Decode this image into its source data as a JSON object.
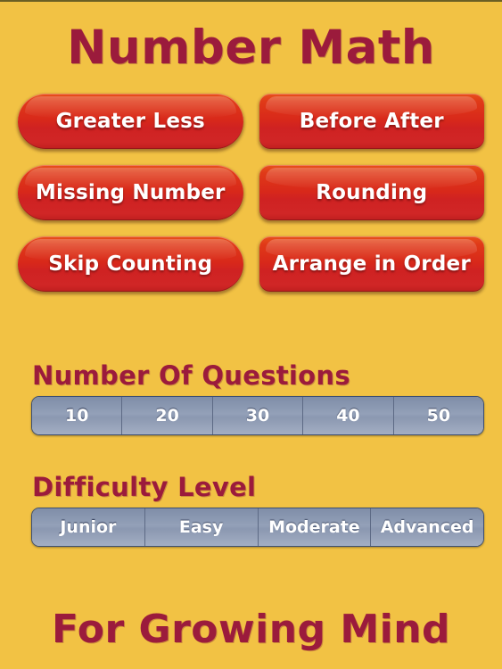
{
  "app": {
    "title": "Number Math",
    "footer": "For Growing Mind",
    "background_color": "#f2c244",
    "title_color": "#9b1b3c",
    "button_color": "#d8281a",
    "segment_selected_color": "#44588a",
    "segment_unselected_color": "#93a0b8"
  },
  "topics": {
    "rows": [
      [
        {
          "label": "Greater Less"
        },
        {
          "label": "Before After"
        }
      ],
      [
        {
          "label": "Missing Number"
        },
        {
          "label": "Rounding"
        }
      ],
      [
        {
          "label": "Skip Counting"
        },
        {
          "label": "Arrange in Order"
        }
      ]
    ]
  },
  "questions": {
    "label": "Number Of Questions",
    "options": [
      "10",
      "20",
      "30",
      "40",
      "50"
    ],
    "selected": "10"
  },
  "difficulty": {
    "label": "Difficulty Level",
    "options": [
      "Junior",
      "Easy",
      "Moderate",
      "Advanced"
    ],
    "selected": "Junior"
  }
}
